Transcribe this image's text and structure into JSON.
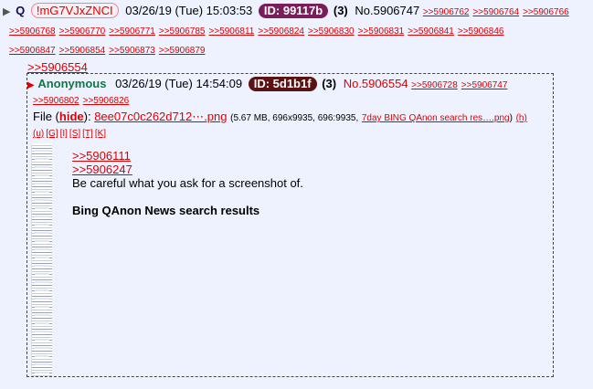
{
  "op": {
    "arrow": "▶",
    "subject": "Q",
    "tripcode": "!mG7VJxZNCI",
    "date": "03/26/19 (Tue) 15:03:53",
    "id_label": "ID: 99117b",
    "id_color": "#7a1e5a",
    "reply_count": "(3)",
    "post_number": "No.5906747",
    "backlinks_row1": [
      ">>5906762",
      ">>5906764",
      ">>5906766"
    ],
    "backlinks_row2": [
      ">>5906768",
      ">>5906770",
      ">>5906771",
      ">>5906785",
      ">>5906811",
      ">>5906824",
      ">>5906830",
      ">>5906831",
      ">>5906841",
      ">>5906846"
    ],
    "backlinks_row3": [
      ">>5906847",
      ">>5906854",
      ">>5906873",
      ">>5906879"
    ]
  },
  "reply": {
    "quote_link": ">>5906554",
    "marker": "▶",
    "name": "Anonymous",
    "date": "03/26/19 (Tue) 14:54:09",
    "id_label": "ID: 5d1b1f",
    "id_color": "#5a1212",
    "reply_count": "(3)",
    "post_number": "No.5906554",
    "backlinks_inline": [
      ">>5906728",
      ">>5906747"
    ],
    "backlinks_row2": [
      ">>5906802",
      ">>5906826"
    ],
    "file": {
      "label": "File (",
      "hide": "hide",
      "after_hide": "):",
      "filename": "8ee07c0c262d712⋯.png",
      "meta": "(5.67 MB, 696x9935, 696:9935,",
      "original_name": "7day BING QAnon search res….png",
      "meta_close": ")",
      "h_link": "(h)",
      "options": [
        "(u)",
        "[G]",
        "[I]",
        "[S]",
        "[T]",
        "[K]"
      ]
    },
    "body": {
      "quotes": [
        ">>5906111",
        ">>5906247"
      ],
      "text": "Be careful what you ask for a screenshot of.",
      "bold_text": "Bing QAnon News search results"
    }
  }
}
